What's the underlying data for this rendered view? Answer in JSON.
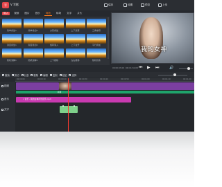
{
  "titlebar": {
    "app_title": "V 写影",
    "logo_text": "写",
    "buttons": [
      "保存",
      "设置",
      "预览",
      "上传"
    ]
  },
  "tabs": [
    "导入",
    "视频",
    "图片",
    "音乐",
    "特效",
    "转场",
    "文字",
    "片头"
  ],
  "active_tab_index": 4,
  "media": [
    {
      "caption": "简单叠加1"
    },
    {
      "caption": "简单叠加2"
    },
    {
      "caption": "方形叠加"
    },
    {
      "caption": "上下遮幕"
    },
    {
      "caption": "三角卷帘"
    },
    {
      "caption": "渐变叠加1"
    },
    {
      "caption": "渐变叠加2"
    },
    {
      "caption": "旋转渐入"
    },
    {
      "caption": "上下拉开"
    },
    {
      "caption": "平行叠加"
    },
    {
      "caption": "随机溶解1"
    },
    {
      "caption": "随机溶解2"
    },
    {
      "caption": "上下推移"
    },
    {
      "caption": "左右推移"
    },
    {
      "caption": "随机线条"
    }
  ],
  "preview": {
    "caption": "我的女神",
    "time": "00:00:03.00 / 00:01:32.08",
    "controls": [
      "⏮",
      "▶",
      "⏭",
      "🔊"
    ]
  },
  "timeline": {
    "tools": [
      "撤销",
      "剪切",
      "分割",
      "删除",
      "编辑",
      "复制",
      "粘贴",
      "选择"
    ],
    "ruler_ticks": [
      "00:00:00",
      "00:00:10",
      "00:00:20",
      "00:00:30",
      "00:00:40",
      "00:00:50",
      "00:01:00",
      "00:01:10",
      "00:01:20"
    ],
    "tracks": [
      {
        "label": "视频"
      },
      {
        "label": "音乐"
      },
      {
        "label": "文字"
      }
    ],
    "green_clip_text": "转场",
    "audio_clip_text": "♪ 音乐 - 我的女神背景音乐.mp3"
  },
  "colors": {
    "accent": "#ff7a1a",
    "brand_red": "#e5484d",
    "video_clip": "#7b3fa0",
    "audio_clip": "#c93ab0",
    "text_clip": "#7ed08a",
    "transition_clip": "#1fa46b",
    "playhead": "#ff3b30"
  }
}
